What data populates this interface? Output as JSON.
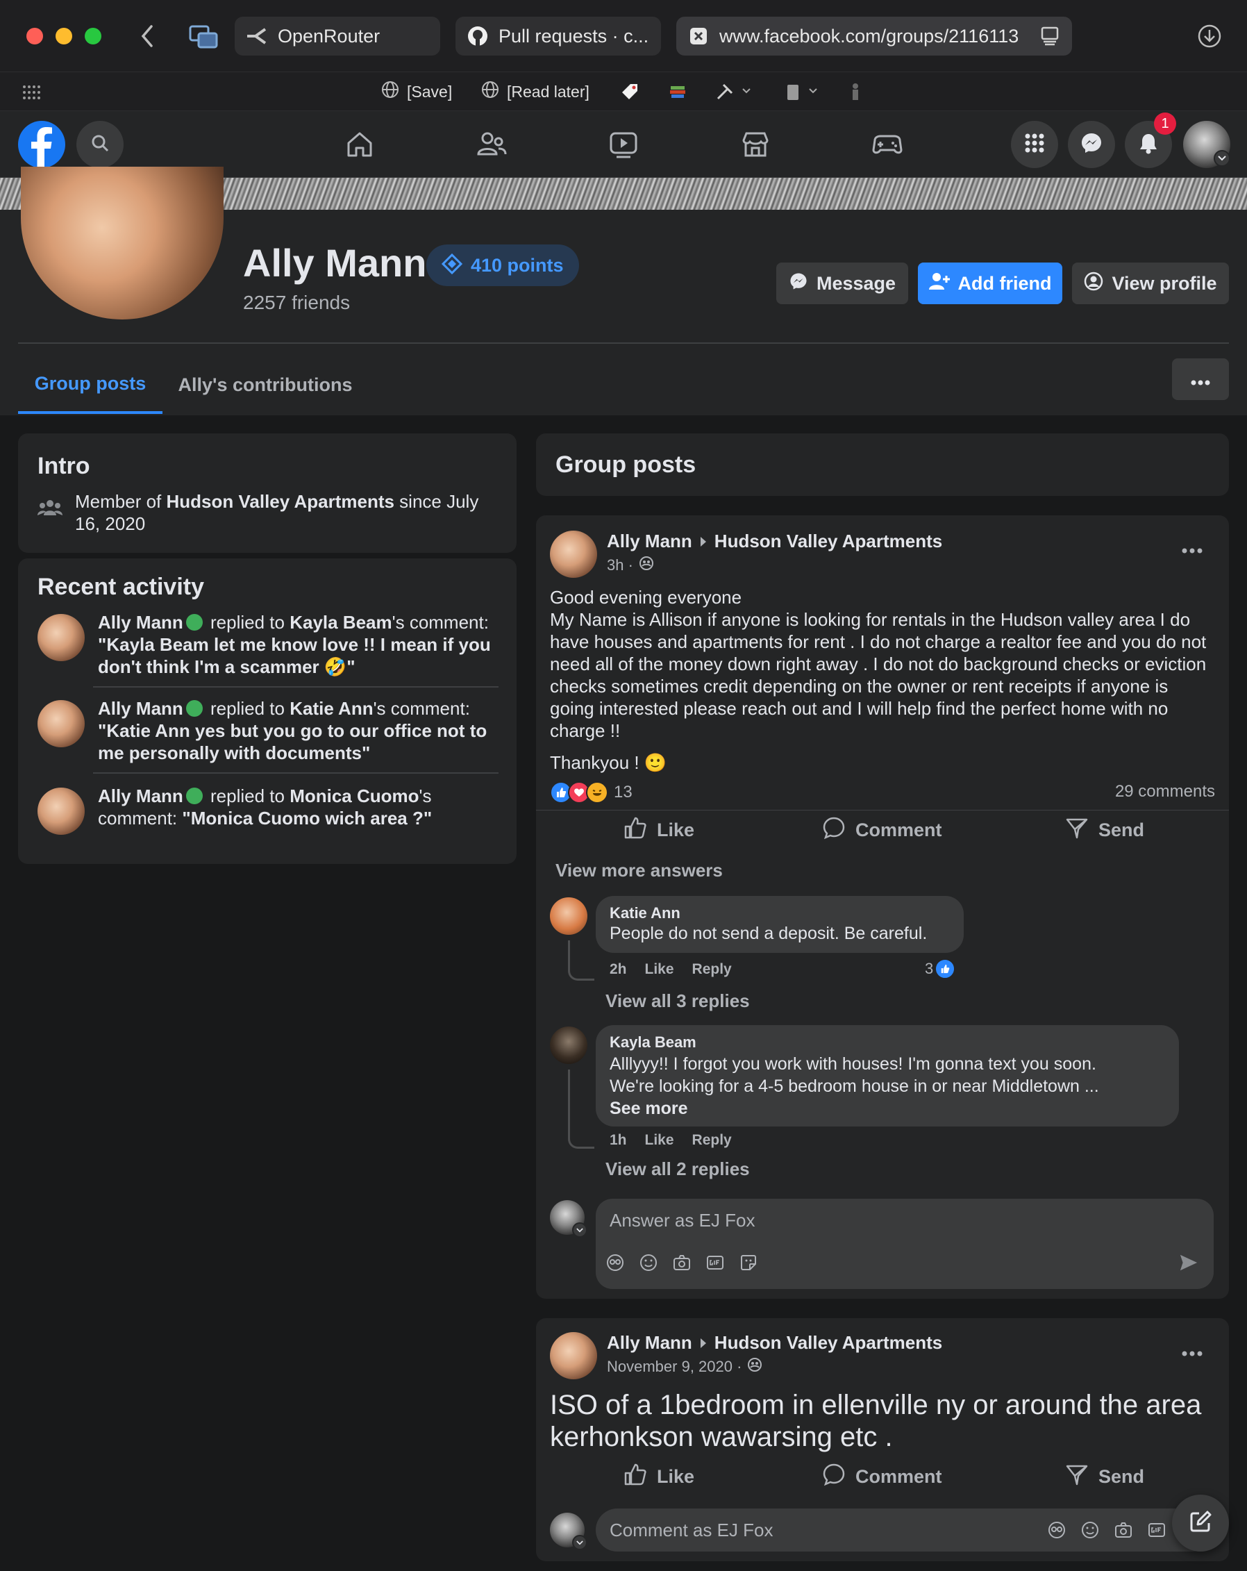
{
  "browser": {
    "tabs": [
      {
        "label": "OpenRouter"
      },
      {
        "label": "Pull requests · c..."
      },
      {
        "label": "www.facebook.com/groups/2116113"
      }
    ],
    "bookmarks": [
      {
        "label": "[Save]"
      },
      {
        "label": "[Read later]"
      }
    ]
  },
  "nav": {
    "notification_count": "1"
  },
  "profile": {
    "name": "Ally Mann",
    "points": "410 points",
    "friends": "2257 friends",
    "buttons": {
      "message": "Message",
      "add_friend": "Add friend",
      "view_profile": "View profile"
    },
    "tabs": [
      {
        "label": "Group posts",
        "active": true
      },
      {
        "label": "Ally's contributions",
        "active": false
      }
    ]
  },
  "intro": {
    "title": "Intro",
    "member_prefix": "Member of ",
    "group": "Hudson Valley Apartments",
    "since": " since July 16, 2020"
  },
  "recent": {
    "title": "Recent activity",
    "items": [
      {
        "actor": "Ally Mann",
        "verb": " replied to ",
        "target": "Kayla Beam",
        "suffix": "'s comment: ",
        "quote": "\"Kayla Beam let me know love !! I mean if you don't think I'm a scammer 🤣\""
      },
      {
        "actor": "Ally Mann",
        "verb": " replied to ",
        "target": "Katie Ann",
        "suffix": "'s comment: ",
        "quote": "\"Katie Ann yes but you go to our office not to me personally with documents\""
      },
      {
        "actor": "Ally Mann",
        "verb": " replied to ",
        "target": "Monica Cuomo",
        "suffix": "'s comment: ",
        "quote": "\"Monica Cuomo wich area ?\""
      }
    ]
  },
  "feed": {
    "title": "Group posts",
    "post1": {
      "author": "Ally Mann",
      "group": "Hudson Valley Apartments",
      "time": "3h ·",
      "body": "Good evening everyone\nMy Name is Allison if anyone is looking for rentals in the Hudson valley area I do have houses and apartments for rent . I do not charge a realtor fee and you do not need all of the money down right away . I do not do background checks or eviction checks sometimes credit depending on the owner or rent receipts if anyone is going interested please reach out and I will help find the perfect home with no charge !!",
      "thanks": "Thankyou ! 🙂",
      "reactions": "13",
      "comments": "29 comments",
      "actions": {
        "like": "Like",
        "comment": "Comment",
        "send": "Send"
      },
      "view_more": "View more answers",
      "comment1": {
        "author": "Katie Ann",
        "text": "People do not send a deposit. Be careful.",
        "time": "2h",
        "like": "Like",
        "reply": "Reply",
        "likes": "3",
        "view_replies": "View all 3 replies"
      },
      "comment2": {
        "author": "Kayla Beam",
        "line1": "Alllyyy!! I forgot you work with houses! I'm gonna text you soon.",
        "line2": "We're looking for a 4-5 bedroom house in or near Middletown ...",
        "see_more": "See more",
        "time": "1h",
        "like": "Like",
        "reply": "Reply",
        "view_replies": "View all 2 replies"
      },
      "answer_placeholder": "Answer as EJ Fox"
    },
    "post2": {
      "author": "Ally Mann",
      "group": "Hudson Valley Apartments",
      "time": "November 9, 2020 ·",
      "body": "ISO of a 1bedroom in ellenville ny or around the area kerhonkson wawarsing etc .",
      "actions": {
        "like": "Like",
        "comment": "Comment",
        "send": "Send"
      },
      "comment_placeholder": "Comment as EJ Fox"
    }
  },
  "colors": {
    "accent": "#2d88ff",
    "link_blue": "#4599ff",
    "background": "#18191a",
    "card": "#242526"
  }
}
